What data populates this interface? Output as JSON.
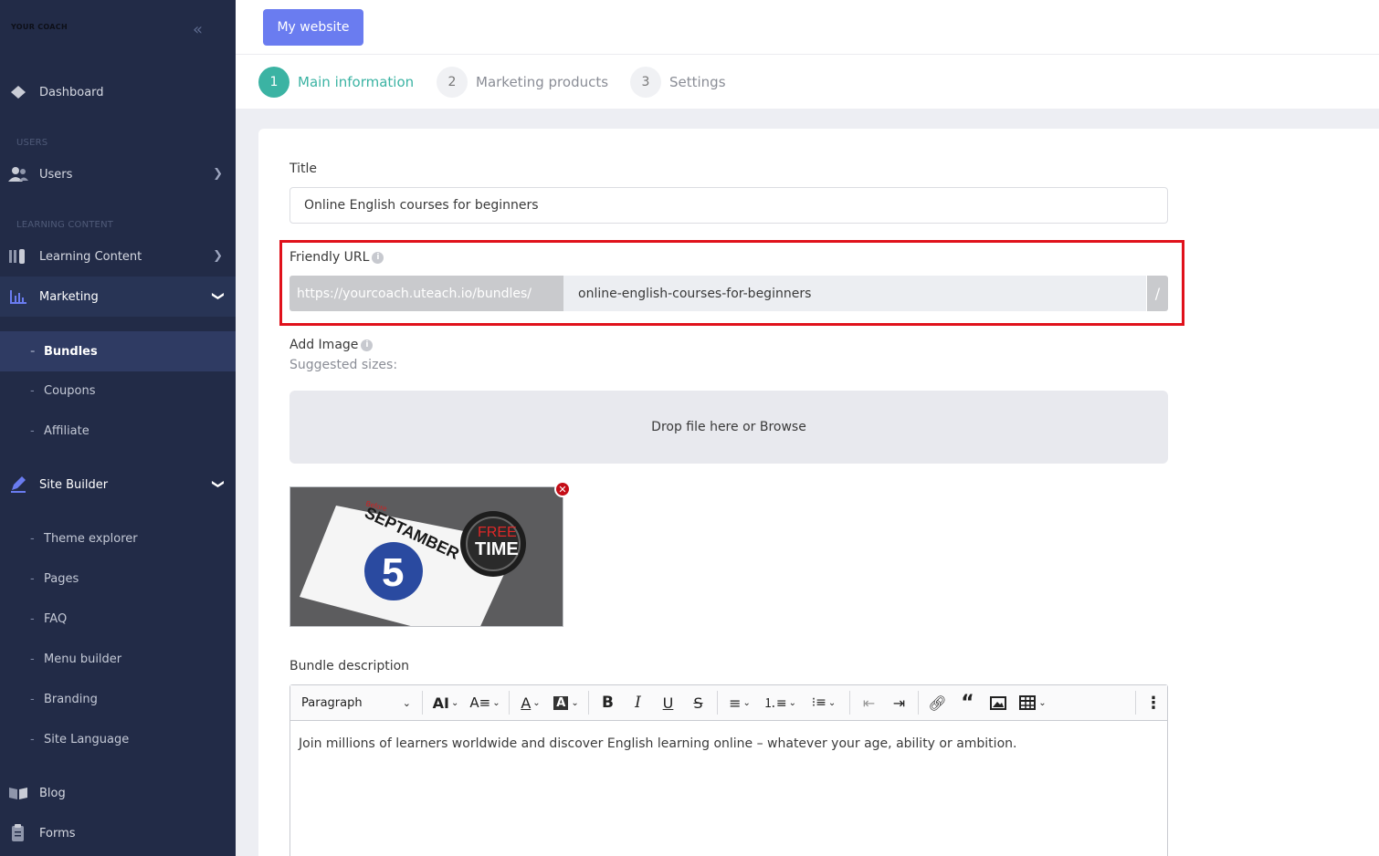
{
  "sidebar": {
    "logo": "YOUR COACH",
    "collapse_icon": "double-chevron-left-icon",
    "dashboard": "Dashboard",
    "section_users": "USERS",
    "users": "Users",
    "section_learning": "LEARNING CONTENT",
    "learning_content": "Learning Content",
    "marketing": "Marketing",
    "marketing_sub": [
      "Bundles",
      "Coupons",
      "Affiliate"
    ],
    "site_builder": "Site Builder",
    "site_builder_sub": [
      "Theme explorer",
      "Pages",
      "FAQ",
      "Menu builder",
      "Branding",
      "Site Language"
    ],
    "blog": "Blog",
    "forms": "Forms"
  },
  "topbar": {
    "my_website": "My website"
  },
  "steps": [
    {
      "num": "1",
      "label": "Main information"
    },
    {
      "num": "2",
      "label": "Marketing products"
    },
    {
      "num": "3",
      "label": "Settings"
    }
  ],
  "form": {
    "title_label": "Title",
    "title_value": "Online English courses for beginners",
    "friendly_url_label": "Friendly URL",
    "url_prefix": "https://yourcoach.uteach.io/bundles/",
    "url_slug": "online-english-courses-for-beginners",
    "url_suffix": "/",
    "add_image_label": "Add Image",
    "suggested_sizes": "Suggested sizes:",
    "dropzone_text": "Drop file here or Browse",
    "remove_icon": "close-icon",
    "image_text": {
      "before": "Before",
      "month": "SEPTAMBER",
      "day": "5",
      "clock_line1": "FREE",
      "clock_line2": "TIME"
    },
    "description_label": "Bundle description"
  },
  "editor": {
    "paragraph": "Paragraph",
    "content": "Join millions of learners worldwide and discover English learning online – whatever your age, ability or ambition."
  },
  "colors": {
    "sidebar_bg": "#222b47",
    "accent_teal": "#3bb3a3",
    "button_blue": "#6a7cf0",
    "highlight_red": "#e0111b"
  }
}
